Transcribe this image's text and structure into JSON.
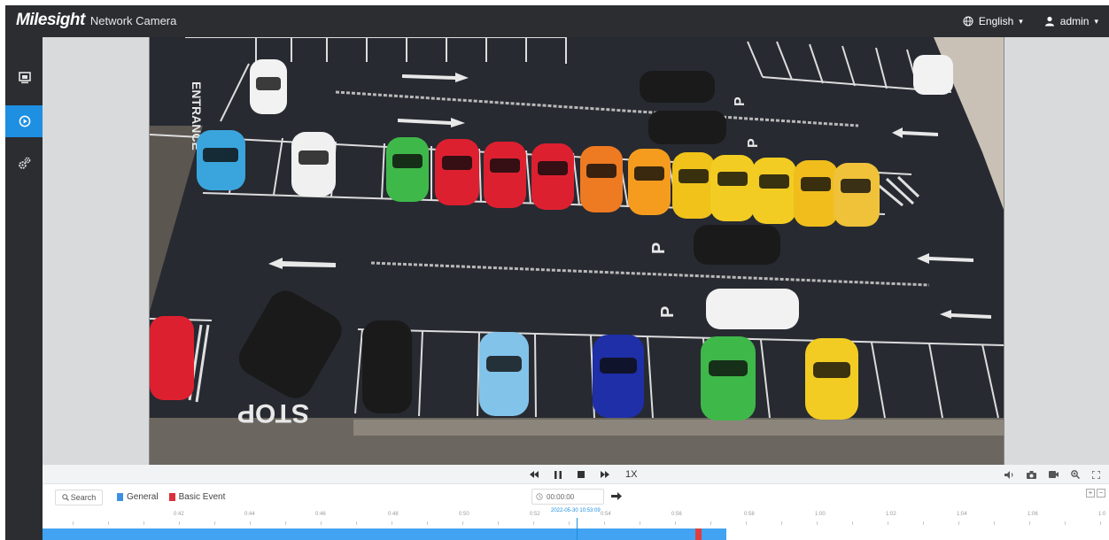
{
  "header": {
    "brand": "Milesight",
    "product": "Network Camera",
    "language": "English",
    "user": "admin"
  },
  "sidebar": {
    "items": [
      {
        "icon": "live-view-icon",
        "active": false
      },
      {
        "icon": "playback-icon",
        "active": true
      },
      {
        "icon": "settings-icon",
        "active": false
      }
    ]
  },
  "video": {
    "markings": [
      "ENTRANCE",
      "STOP",
      "P",
      "P",
      "P",
      "P"
    ]
  },
  "controls": {
    "speed": "1X"
  },
  "timeline": {
    "search_label": "Search",
    "legend": [
      {
        "label": "General",
        "color": "#3d8fe0"
      },
      {
        "label": "Basic Event",
        "color": "#d9303b"
      }
    ],
    "time_value": "00:00:00",
    "current_time": "2022-05-30 10:53:09",
    "ticks": [
      "0:42",
      "0:44",
      "0:46",
      "0:48",
      "0:50",
      "0:52",
      "0:54",
      "0:56",
      "0:58",
      "1:00",
      "1:02",
      "1:04",
      "1:06",
      "1:0"
    ]
  },
  "colors": {
    "accent": "#1e8fe1",
    "topbar": "#2b2d31",
    "record_bar": "#41a3f1",
    "event": "#e03d3d"
  }
}
